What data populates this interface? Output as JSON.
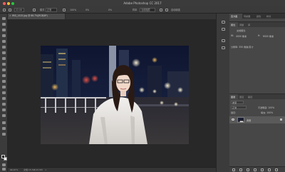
{
  "window": {
    "title": "Adobe Photoshop CC 2017"
  },
  "options_bar": {
    "tolerance": "22.00",
    "mode_label": "模式",
    "mode_value": "正常",
    "amount": "100%",
    "percent_a": "0%",
    "percent_b": "0%",
    "sample_label": "样本",
    "sample_value": "当前图层",
    "extra_option": "自动增强"
  },
  "document": {
    "tab_label": "IMG_1415.jpg @ 66.7%(RGB/8*)",
    "zoom": "66.67%",
    "doc_size": "文档:15.5M/15.5M"
  },
  "panels": {
    "top_tabs": [
      "直方图",
      "导航器",
      "颜色",
      "样式"
    ],
    "properties_tabs": [
      "属性",
      "调整",
      "库"
    ],
    "properties_title": "文档属性",
    "props": {
      "w_label": "W:",
      "w_value": "4000 像素",
      "h_label": "H:",
      "h_value": "6000 像素",
      "resolution": "分辨率: 350 像素/英寸"
    },
    "layers_tabs": [
      "图层",
      "通道",
      "路径"
    ],
    "kind_label": "类型",
    "blend_mode": "正常",
    "opacity_label": "不透明度: 100%",
    "fill_label": "填充: 100%",
    "lock_label": "锁定:",
    "layer_name": "背景"
  },
  "colors": {
    "accent": "#3a7fd5",
    "panel_bg": "#474747",
    "canvas_bg": "#282828"
  }
}
